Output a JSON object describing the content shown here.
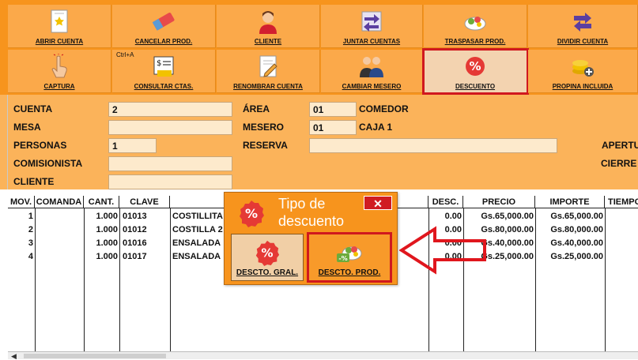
{
  "toolbar": {
    "row1": [
      {
        "name": "abrir-cuenta-button",
        "label": "ABRIR CUENTA",
        "icon": "receipt-star-icon"
      },
      {
        "name": "cancelar-prod-button",
        "label": "CANCELAR PROD.",
        "icon": "eraser-icon"
      },
      {
        "name": "cliente-button",
        "label": "CLIENTE",
        "icon": "person-icon"
      },
      {
        "name": "juntar-cuentas-button",
        "label": "JUNTAR CUENTAS",
        "icon": "merge-arrows-icon"
      },
      {
        "name": "traspasar-prod-button",
        "label": "TRASPASAR PROD.",
        "icon": "transfer-food-icon"
      },
      {
        "name": "dividir-cuenta-button",
        "label": "DIVIDIR CUENTA",
        "icon": "split-arrows-icon"
      }
    ],
    "row2": [
      {
        "name": "captura-button",
        "label": "CAPTURA",
        "icon": "touch-hand-icon"
      },
      {
        "name": "consultar-ctas-button",
        "label": "CONSULTAR CTAS.",
        "icon": "money-bill-icon",
        "shortcut": "Ctrl+A"
      },
      {
        "name": "renombrar-cuenta-button",
        "label": "RENOMBRAR CUENTA",
        "icon": "rename-pencil-icon"
      },
      {
        "name": "cambiar-mesero-button",
        "label": "CAMBIAR MESERO",
        "icon": "waiters-icon"
      },
      {
        "name": "descuento-button",
        "label": "DESCUENTO",
        "icon": "percent-badge-icon",
        "active": true
      },
      {
        "name": "propina-incluida-button",
        "label": "PROPINA INCLUIDA",
        "icon": "coins-plus-icon"
      }
    ]
  },
  "form": {
    "cuenta_label": "CUENTA",
    "cuenta_value": "2",
    "mesa_label": "MESA",
    "mesa_value": "",
    "personas_label": "PERSONAS",
    "personas_value": "1",
    "comisionista_label": "COMISIONISTA",
    "comisionista_value": "",
    "cliente_label": "CLIENTE",
    "cliente_value": "",
    "area_label": "ÁREA",
    "area_code": "01",
    "area_name": "COMEDOR",
    "mesero_label": "MESERO",
    "mesero_code": "01",
    "mesero_name": "CAJA 1",
    "reserva_label": "RESERVA",
    "reserva_value": "",
    "apertura_label": "APERTU",
    "cierre_label": "CIERRE"
  },
  "grid": {
    "headers": [
      "MOV.",
      "COMANDA",
      "CANT.",
      "CLAVE",
      "",
      "DESC.",
      "PRECIO",
      "IMPORTE",
      "TIEMPO"
    ],
    "rows": [
      {
        "mov": "1",
        "comanda": "",
        "cant": "1.000",
        "clave": "01013",
        "desc_text": "COSTILLITA",
        "desc": "0.00",
        "precio": "Gs.65,000.00",
        "importe": "Gs.65,000.00"
      },
      {
        "mov": "2",
        "comanda": "",
        "cant": "1.000",
        "clave": "01012",
        "desc_text": "COSTILLA 2",
        "desc": "0.00",
        "precio": "Gs.80,000.00",
        "importe": "Gs.80,000.00"
      },
      {
        "mov": "3",
        "comanda": "",
        "cant": "1.000",
        "clave": "01016",
        "desc_text": "ENSALADA",
        "desc": "0.00",
        "precio": "Gs.40,000.00",
        "importe": "Gs.40,000.00"
      },
      {
        "mov": "4",
        "comanda": "",
        "cant": "1.000",
        "clave": "01017",
        "desc_text": "ENSALADA",
        "desc": "0.00",
        "precio": "Gs.25,000.00",
        "importe": "Gs.25,000.00"
      }
    ]
  },
  "dialog": {
    "title": "Tipo de descuento",
    "close": "✕",
    "gral_label": "DESCTO. GRAL.",
    "prod_label": "DESCTO. PROD."
  },
  "colors": {
    "toolbar_bg": "#f7941d",
    "form_bg": "#fbb35a",
    "highlight": "#d0181e"
  }
}
